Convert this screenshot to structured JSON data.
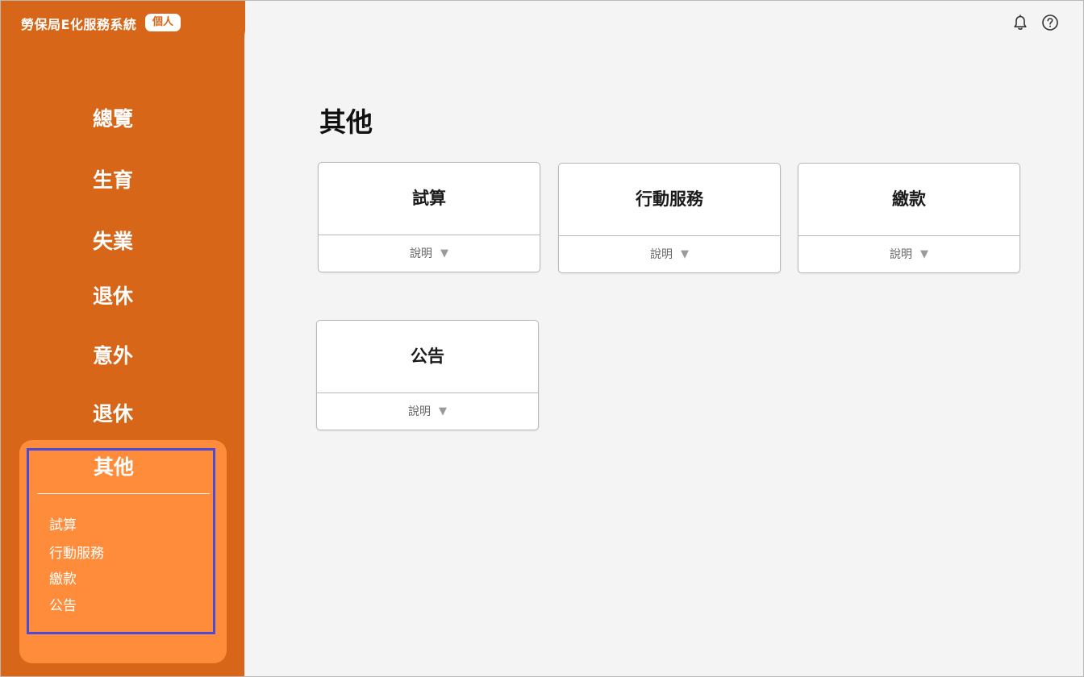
{
  "app": {
    "title": "勞保局E化服務系統",
    "badge": "個人"
  },
  "sidebar": {
    "items": [
      {
        "label": "總覽"
      },
      {
        "label": "生育"
      },
      {
        "label": "失業"
      },
      {
        "label": "退休"
      },
      {
        "label": "意外"
      },
      {
        "label": "退休"
      }
    ],
    "expanded": {
      "label": "其他",
      "subitems": [
        {
          "label": "試算"
        },
        {
          "label": "行動服務"
        },
        {
          "label": "繳款"
        },
        {
          "label": "公告"
        }
      ]
    }
  },
  "header": {
    "icons": [
      "bell-icon",
      "help-icon"
    ]
  },
  "main": {
    "title": "其他",
    "cards": [
      {
        "title": "試算",
        "help": "說明"
      },
      {
        "title": "行動服務",
        "help": "說明"
      },
      {
        "title": "繳款",
        "help": "說明"
      },
      {
        "title": "公告",
        "help": "說明"
      }
    ]
  },
  "colors": {
    "sidebar": "#d86618",
    "expanded_panel": "#ff8c3a",
    "highlight": "#4b4bd8",
    "background": "#f4f4f4"
  }
}
